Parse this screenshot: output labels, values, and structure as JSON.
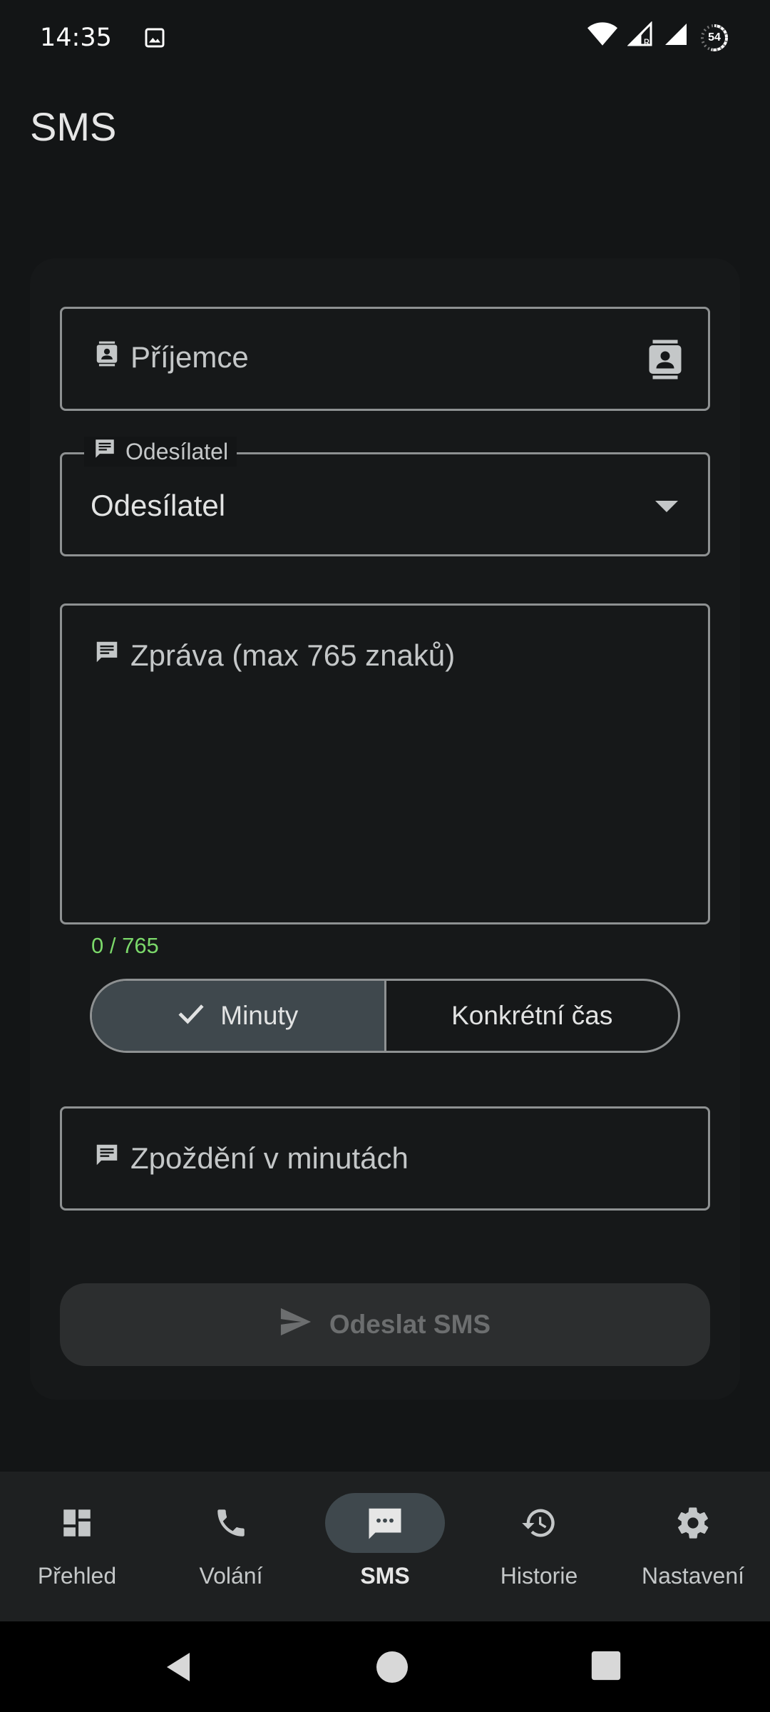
{
  "status_bar": {
    "time": "14:35",
    "battery_level": "54",
    "icons": [
      "image-icon",
      "wifi-icon",
      "signal-roaming-icon",
      "signal-icon",
      "battery-icon"
    ]
  },
  "app_bar": {
    "title": "SMS"
  },
  "form": {
    "recipient": {
      "placeholder": "Příjemce",
      "value": ""
    },
    "sender": {
      "label": "Odesílatel",
      "value": "Odesílatel"
    },
    "message": {
      "placeholder": "Zpráva (max 765 znaků)",
      "value": "",
      "counter": "0 / 765"
    },
    "schedule_mode": {
      "options": [
        {
          "label": "Minuty",
          "selected": true
        },
        {
          "label": "Konkrétní čas",
          "selected": false
        }
      ]
    },
    "delay": {
      "placeholder": "Zpoždění v minutách",
      "value": ""
    },
    "send_button": {
      "label": "Odeslat SMS",
      "enabled": false
    }
  },
  "bottom_nav": {
    "items": [
      {
        "label": "Přehled",
        "icon": "dashboard-icon",
        "active": false
      },
      {
        "label": "Volání",
        "icon": "phone-icon",
        "active": false
      },
      {
        "label": "SMS",
        "icon": "sms-icon",
        "active": true
      },
      {
        "label": "Historie",
        "icon": "history-icon",
        "active": false
      },
      {
        "label": "Nastavení",
        "icon": "settings-icon",
        "active": false
      }
    ]
  },
  "colors": {
    "background": "#131516",
    "counter": "#7bd86a",
    "selected_segment": "#3f484d",
    "nav_bar": "#1e2021"
  }
}
